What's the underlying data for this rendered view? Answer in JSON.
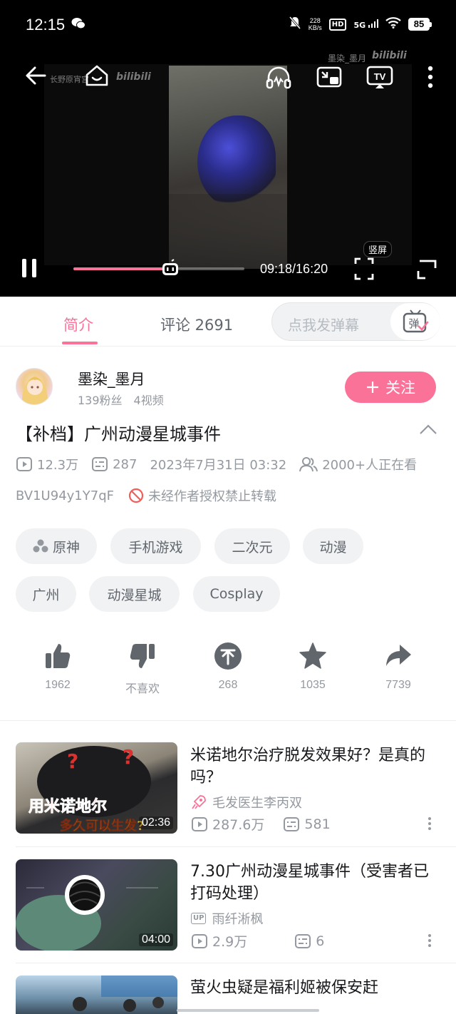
{
  "statusbar": {
    "time": "12:15",
    "net_speed_top": "228",
    "net_speed_bottom": "KB/s",
    "hd": "HD",
    "network": "5G",
    "battery": "85"
  },
  "player": {
    "watermark_left": "长野原宵宫",
    "watermark_right": "墨染_墨月",
    "watermark_logo": "bilibili",
    "progress": 0.5723,
    "time_label": "09:18/16:20",
    "vertical_tag": "竖屏"
  },
  "tabs": {
    "intro": "简介",
    "comments": "评论 2691",
    "danmaku_placeholder": "点我发弹幕",
    "danmaku_button": "弹"
  },
  "uploader": {
    "name": "墨染_墨月",
    "fans": "139粉丝",
    "videos": "4视频",
    "follow_label": "关注"
  },
  "video": {
    "title": "【补档】广州动漫星城事件",
    "views": "12.3万",
    "danmaku_count": "287",
    "date": "2023年7月31日 03:32",
    "watching": "2000+人正在看",
    "bvid": "BV1U94y1Y7qF",
    "copyright": "未经作者授权禁止转载"
  },
  "tags": [
    "原神",
    "手机游戏",
    "二次元",
    "动漫",
    "广州",
    "动漫星城",
    "Cosplay"
  ],
  "actions": {
    "like": "1962",
    "dislike": "不喜欢",
    "coin": "268",
    "favorite": "1035",
    "share": "7739"
  },
  "related": [
    {
      "title": "米诺地尔治疗脱发效果好？是真的吗？",
      "author": "毛发医生李丙双",
      "views": "287.6万",
      "danmaku": "581",
      "duration": "02:36",
      "thumb_caption_1": "用米诺地尔",
      "thumb_caption_2": "多久可以生发?"
    },
    {
      "title": "7.30广州动漫星城事件（受害者已打码处理）",
      "author": "雨纤淅枫",
      "views": "2.9万",
      "danmaku": "6",
      "duration": "04:00",
      "up_badge": "UP"
    },
    {
      "title": "萤火虫疑是福利姬被保安赶"
    }
  ]
}
